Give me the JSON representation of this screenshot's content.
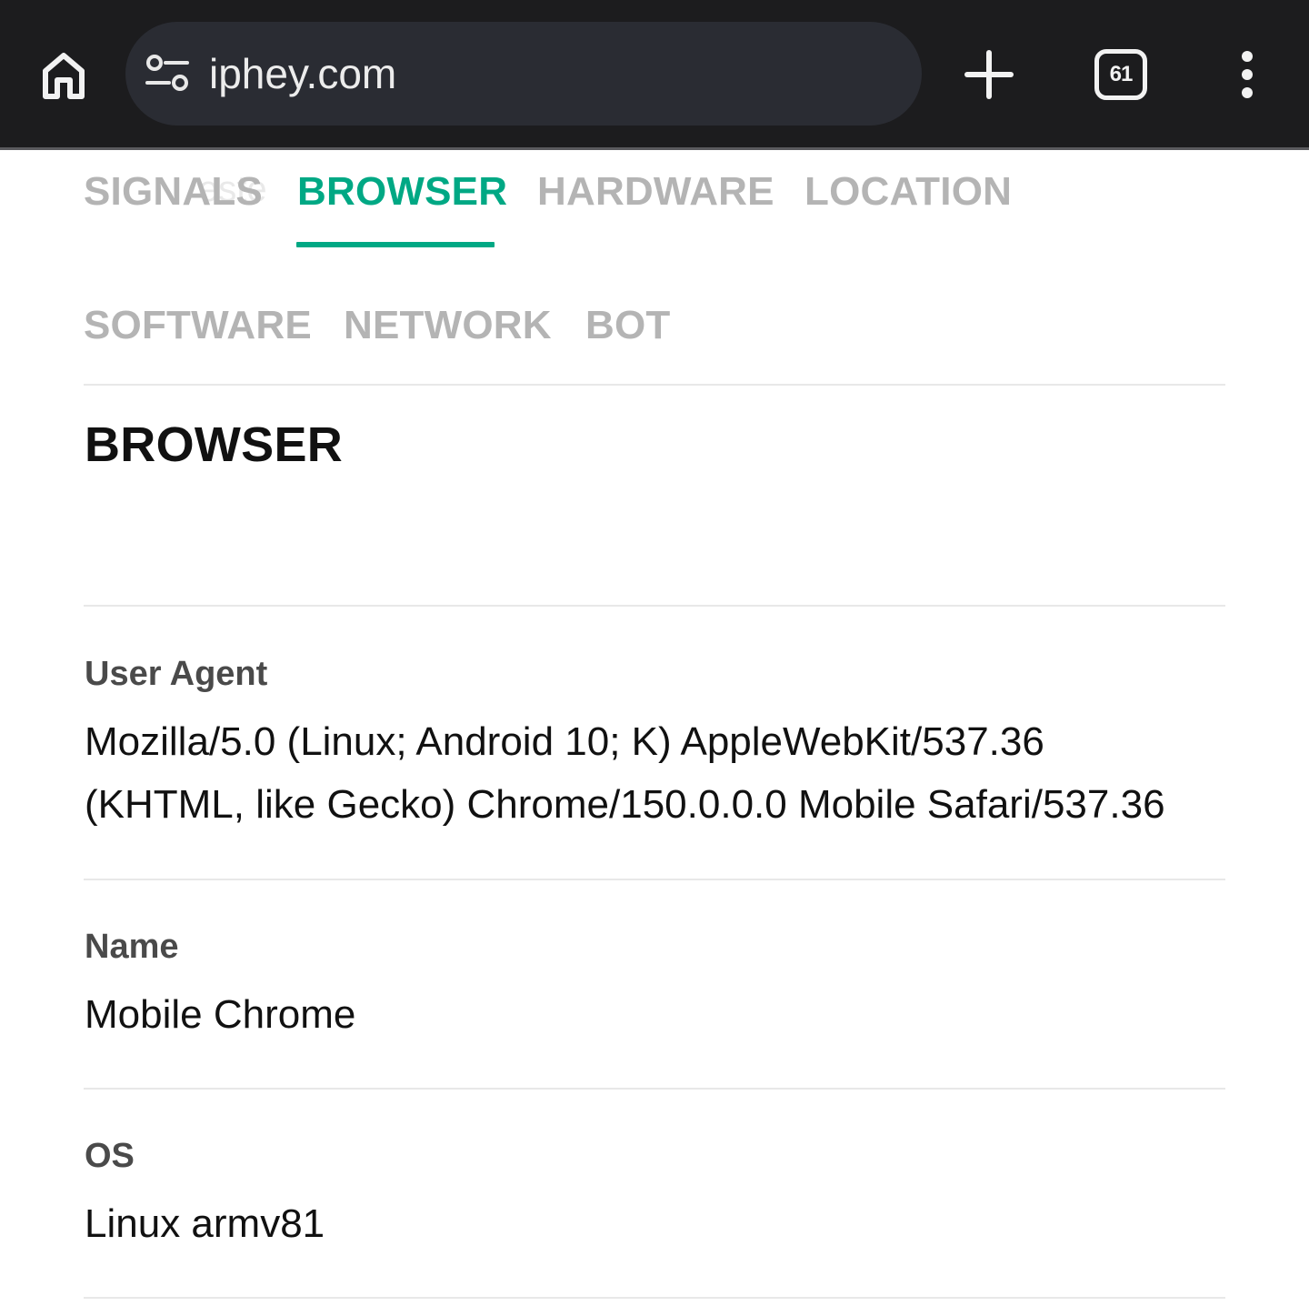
{
  "browser": {
    "url": "iphey.com",
    "tab_count": "61",
    "icons": {
      "home": "home-icon",
      "site_info": "tune-icon",
      "new_tab": "plus-icon",
      "tabs": "tab-switcher-icon",
      "menu": "more-vert-icon"
    }
  },
  "page": {
    "ghost_text": "este",
    "tabs": [
      {
        "label": "SIGNALS",
        "active": false
      },
      {
        "label": "BROWSER",
        "active": true
      },
      {
        "label": "HARDWARE",
        "active": false
      },
      {
        "label": "LOCATION",
        "active": false
      },
      {
        "label": "SOFTWARE",
        "active": false
      },
      {
        "label": "NETWORK",
        "active": false
      },
      {
        "label": "BOT",
        "active": false
      }
    ],
    "section_title": "BROWSER",
    "fields": [
      {
        "label": "User Agent",
        "value_lines": [
          "Mozilla/5.0 (Linux; Android 10; K) AppleWebKit/537.36",
          "(KHTML, like Gecko) Chrome/150.0.0.0 Mobile Safari/537.36"
        ]
      },
      {
        "label": "Name",
        "value_lines": [
          "Mobile Chrome"
        ]
      },
      {
        "label": "OS",
        "value_lines": [
          "Linux armv81"
        ]
      }
    ]
  },
  "colors": {
    "accent": "#00a884",
    "inactive_tab": "#b4b4b4",
    "toolbar_bg": "#1c1c1e",
    "omnibox_bg": "#2a2c33"
  }
}
